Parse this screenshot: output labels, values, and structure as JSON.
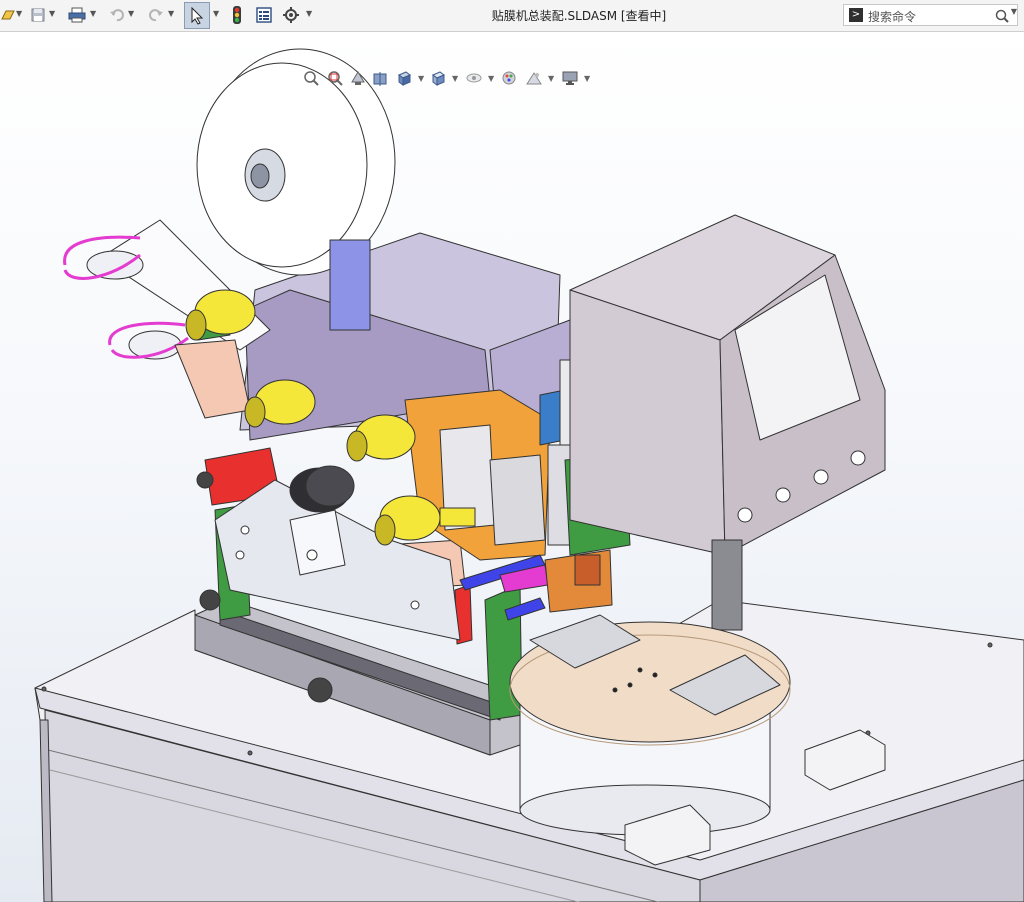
{
  "window": {
    "title": "贴膜机总装配.SLDASM [查看中]"
  },
  "search": {
    "placeholder": "搜索命令",
    "prompt_glyph": ">"
  },
  "toolbar": {
    "items": [
      {
        "name": "open-icon"
      },
      {
        "name": "save-icon"
      },
      {
        "name": "print-icon"
      },
      {
        "name": "undo-icon"
      },
      {
        "name": "redo-icon"
      },
      {
        "name": "select-icon",
        "active": true
      },
      {
        "name": "rebuild-icon"
      },
      {
        "name": "file-properties-icon"
      },
      {
        "name": "options-icon"
      }
    ]
  },
  "heads_up_toolbar": {
    "items": [
      {
        "name": "zoom-to-fit-icon"
      },
      {
        "name": "zoom-to-area-icon"
      },
      {
        "name": "previous-view-icon"
      },
      {
        "name": "section-view-icon"
      },
      {
        "name": "view-orientation-icon"
      },
      {
        "name": "display-style-icon"
      },
      {
        "name": "hide-show-items-icon"
      },
      {
        "name": "edit-appearance-icon"
      },
      {
        "name": "apply-scene-icon"
      },
      {
        "name": "view-settings-icon"
      }
    ]
  },
  "colors": {
    "titlebar": "#f4f4f4",
    "viewport_top": "#ffffff",
    "viewport_bottom": "#e5eaf2",
    "frame": "#f0eff4",
    "yellow_roller": "#f5e63a",
    "orange_block": "#f2a23a",
    "magenta_spring": "#e43bd0",
    "green_plate": "#3f9c42",
    "blue_shaft": "#3f44e8",
    "red_block": "#e8302f",
    "cabinet": "#d3cbd3",
    "turntable_top": "#f1dcc8"
  }
}
